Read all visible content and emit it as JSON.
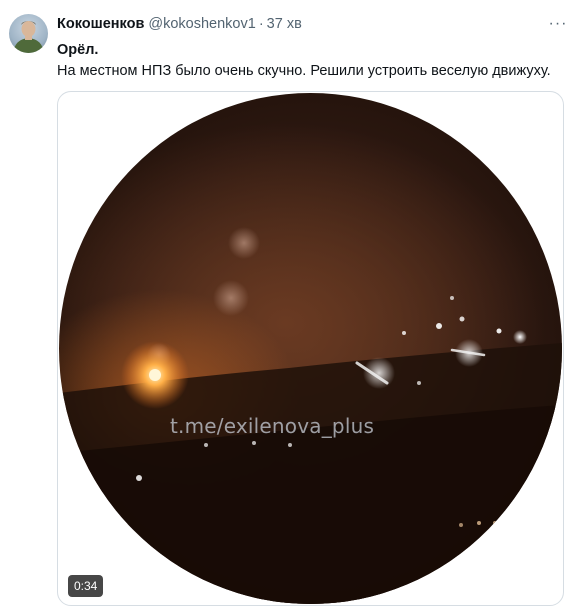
{
  "tweet": {
    "display_name": "Кокошенков",
    "handle": "@kokoshenkov1",
    "separator": "·",
    "time": "37 хв",
    "more_icon": "ellipsis-icon",
    "more_label": "···",
    "title": "Орёл.",
    "body": "На местном НПЗ было очень скучно. Решили устроить веселую движуху.",
    "media": {
      "type": "video",
      "watermark": "t.me/exilenova_plus",
      "duration": "0:34"
    }
  },
  "colors": {
    "text_primary": "#0f1419",
    "text_secondary": "#536471",
    "fire_glow": "#e67828"
  }
}
